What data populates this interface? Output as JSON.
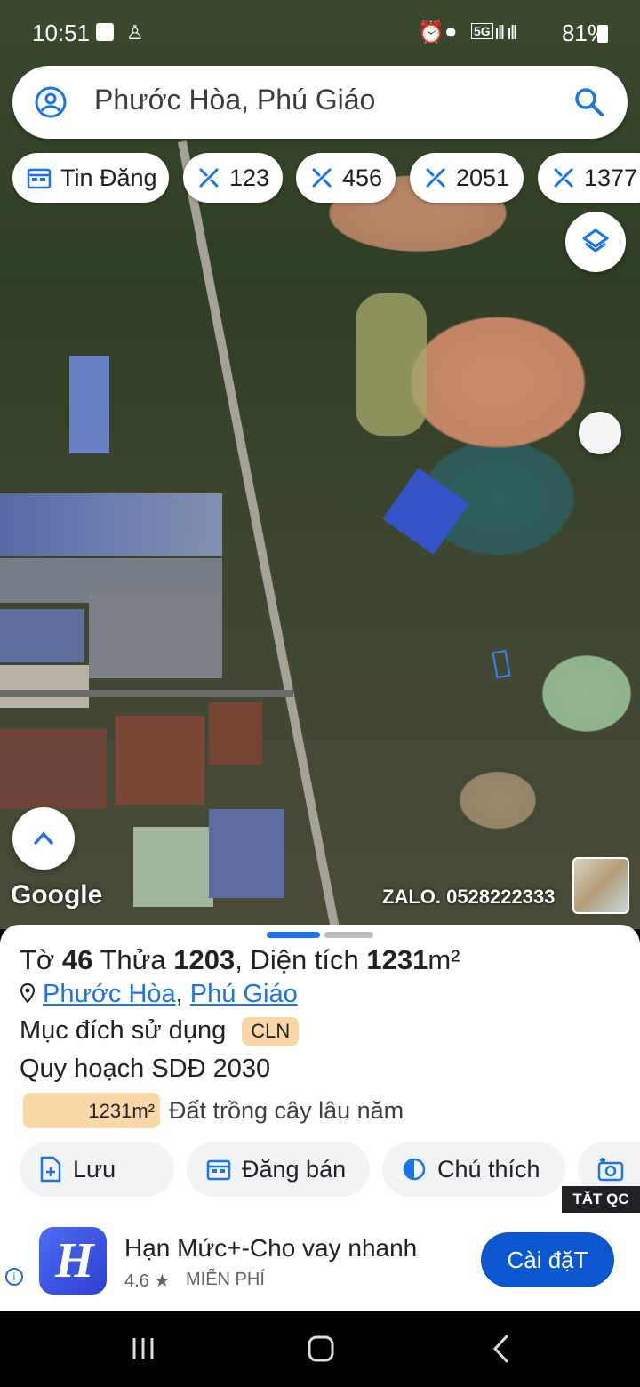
{
  "status_bar": {
    "time": "10:51",
    "network": "5G",
    "battery": "81%"
  },
  "search": {
    "query": "Phước Hòa, Phú Giáo"
  },
  "chips": [
    {
      "label": "Tin Đăng",
      "icon": "calendar-icon"
    },
    {
      "label": "123",
      "icon": "ruler-icon"
    },
    {
      "label": "456",
      "icon": "ruler-icon"
    },
    {
      "label": "2051",
      "icon": "ruler-icon"
    },
    {
      "label": "1377",
      "icon": "ruler-icon"
    }
  ],
  "map": {
    "watermark": "Google",
    "contact": "ZALO. 0528222333"
  },
  "parcel": {
    "to_label": "Tờ",
    "to_value": "46",
    "thua_label": "Thửa",
    "thua_value": "1203",
    "area_label": ", Diện tích",
    "area_value": "1231",
    "area_unit": "m²",
    "location_ward": "Phước Hòa",
    "location_district": "Phú Giáo",
    "purpose_label": "Mục đích sử dụng",
    "purpose_code": "CLN",
    "plan_label": "Quy hoạch SDĐ 2030",
    "plan_area": "1231m²",
    "plan_desc": "Đất trồng cây lâu năm"
  },
  "actions": [
    {
      "label": "Lưu",
      "icon": "add-file-icon"
    },
    {
      "label": "Đăng bán",
      "icon": "calendar-icon"
    },
    {
      "label": "Chú thích",
      "icon": "contrast-icon"
    },
    {
      "label": "",
      "icon": "camera-add-icon"
    }
  ],
  "ad": {
    "hide_label": "TẮT QC",
    "app_name": "Hạn Mức+-Cho vay nhanh",
    "rating": "4.6 ★",
    "price": "MIỄN PHÍ",
    "install_label": "Cài đặT"
  },
  "colors": {
    "accent": "#1a73e8",
    "badge": "#fbd7a8",
    "install_button": "#0b57d0"
  }
}
